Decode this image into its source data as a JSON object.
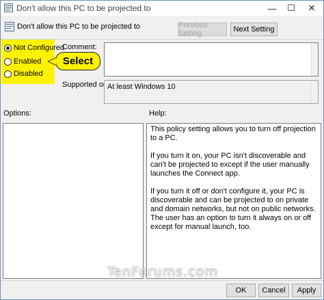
{
  "window": {
    "title": "Don't allow this PC to be projected to",
    "minimize_glyph": "—",
    "maximize_glyph": "☐",
    "close_glyph": "✕"
  },
  "header": {
    "policy_name": "Don't allow this PC to be projected to",
    "previous_label": "Previous Setting",
    "next_label": "Next Setting"
  },
  "state": {
    "options": [
      {
        "label": "Not Configured",
        "checked": true
      },
      {
        "label": "Enabled",
        "checked": false
      },
      {
        "label": "Disabled",
        "checked": false
      }
    ],
    "callout": "Select"
  },
  "comment": {
    "label": "Comment:",
    "value": ""
  },
  "supported": {
    "label": "Supported on:",
    "value": "At least Windows 10"
  },
  "panes": {
    "options_label": "Options:",
    "help_label": "Help:",
    "help_paragraphs": [
      "This policy setting allows you to turn off projection to a PC.",
      "If you turn it on, your PC isn't discoverable and can't be projected to except if the user manually launches the Connect app.",
      "If you turn it off or don't configure it, your PC is discoverable and can be projected to on private and domain networks, but not on public networks. The user has an option to turn it always on or off except for manual launch, too."
    ]
  },
  "footer": {
    "ok_label": "OK",
    "cancel_label": "Cancel",
    "apply_label": "Apply"
  },
  "watermark": "TenForums.com",
  "icons": {
    "title_icon": "policy-settings-icon",
    "header_icon": "policy-settings-icon"
  },
  "colors": {
    "highlight": "#fff200",
    "window_border": "#6b8fb8"
  }
}
